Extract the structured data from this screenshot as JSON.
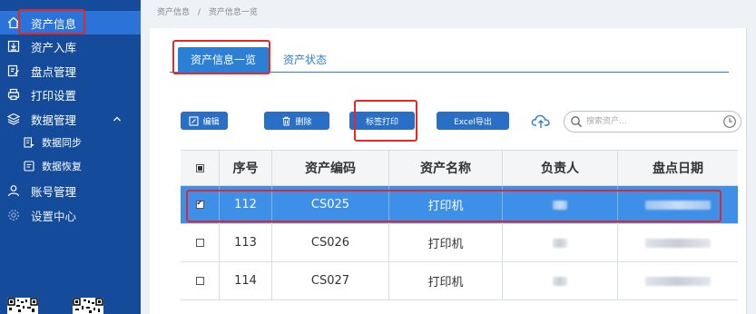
{
  "sidebar": {
    "items": [
      {
        "label": "资产信息",
        "icon": "home-icon"
      },
      {
        "label": "资产入库",
        "icon": "download-icon"
      },
      {
        "label": "盘点管理",
        "icon": "edit-icon"
      },
      {
        "label": "打印设置",
        "icon": "printer-icon"
      },
      {
        "label": "数据管理",
        "icon": "layers-icon"
      },
      {
        "label": "数据同步",
        "icon": "sync-icon"
      },
      {
        "label": "数据恢复",
        "icon": "restore-icon"
      },
      {
        "label": "账号管理",
        "icon": "user-icon"
      },
      {
        "label": "设置中心",
        "icon": "gear-icon"
      }
    ]
  },
  "breadcrumb": {
    "items": [
      "资产信息",
      "/",
      "资产信息一览"
    ]
  },
  "tabs": [
    {
      "label": "资产信息一览"
    },
    {
      "label": "资产状态"
    }
  ],
  "toolbar": {
    "edit_label": "编辑",
    "delete_label": "删除",
    "print_label": "标签打印",
    "export_label": "Excel导出"
  },
  "search": {
    "placeholder": "搜索资产..."
  },
  "table": {
    "headers": [
      "序号",
      "资产编码",
      "资产名称",
      "负责人",
      "盘点日期"
    ],
    "rows": [
      {
        "no": "112",
        "code": "CS025",
        "name": "打印机"
      },
      {
        "no": "113",
        "code": "CS026",
        "name": "打印机"
      },
      {
        "no": "114",
        "code": "CS027",
        "name": "打印机"
      }
    ]
  },
  "colors": {
    "sidebar": "#144b9b",
    "accent": "#2b80d6",
    "selected_row": "#3d8fe8",
    "highlight": "#e02a2a"
  }
}
